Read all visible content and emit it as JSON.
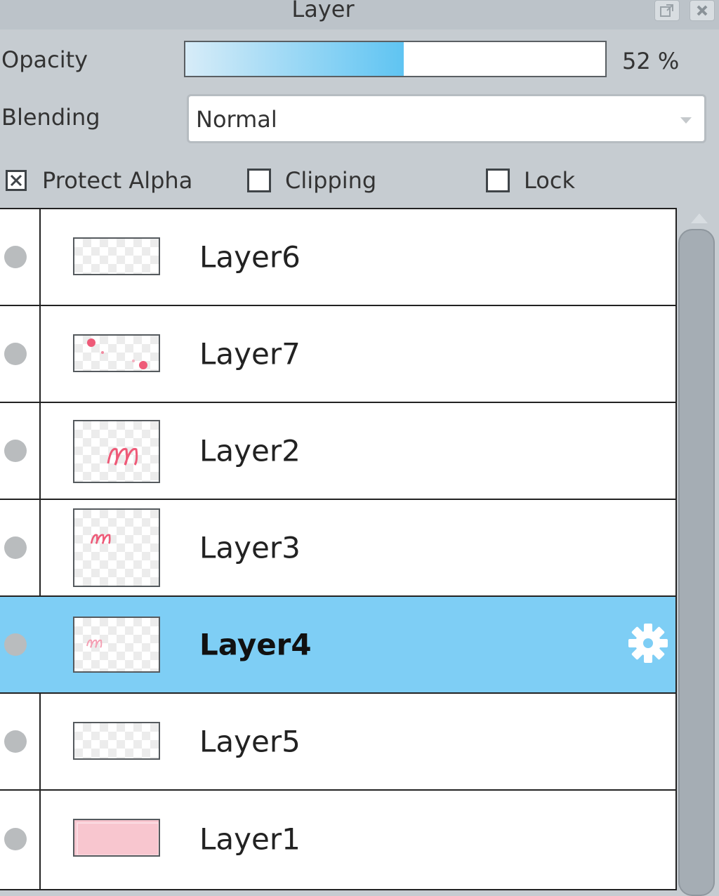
{
  "window": {
    "title": "Layer",
    "float_icon": "float-window-icon",
    "close_icon": "close-icon"
  },
  "opacity": {
    "label": "Opacity",
    "value_text": "52 %",
    "value": 52
  },
  "blending": {
    "label": "Blending",
    "selected": "Normal"
  },
  "checks": {
    "protect_alpha": {
      "label": "Protect Alpha",
      "checked": true
    },
    "clipping": {
      "label": "Clipping",
      "checked": false
    },
    "lock": {
      "label": "Lock",
      "checked": false
    }
  },
  "layers": [
    {
      "name": "Layer6",
      "selected": false,
      "thumb": "empty"
    },
    {
      "name": "Layer7",
      "selected": false,
      "thumb": "pink-dots"
    },
    {
      "name": "Layer2",
      "selected": false,
      "thumb": "pink-glyph"
    },
    {
      "name": "Layer3",
      "selected": false,
      "thumb": "pink-glyph-small"
    },
    {
      "name": "Layer4",
      "selected": true,
      "thumb": "pink-glyph-faint"
    },
    {
      "name": "Layer5",
      "selected": false,
      "thumb": "empty"
    },
    {
      "name": "Layer1",
      "selected": false,
      "thumb": "pink-fill"
    }
  ],
  "colors": {
    "selected_row": "#7ecef5",
    "opacity_fill": "#5fc4f2",
    "panel_bg": "#c6ccd1"
  },
  "icons": {
    "layer_settings": "gear-icon",
    "visibility": "visibility-dot-icon"
  }
}
